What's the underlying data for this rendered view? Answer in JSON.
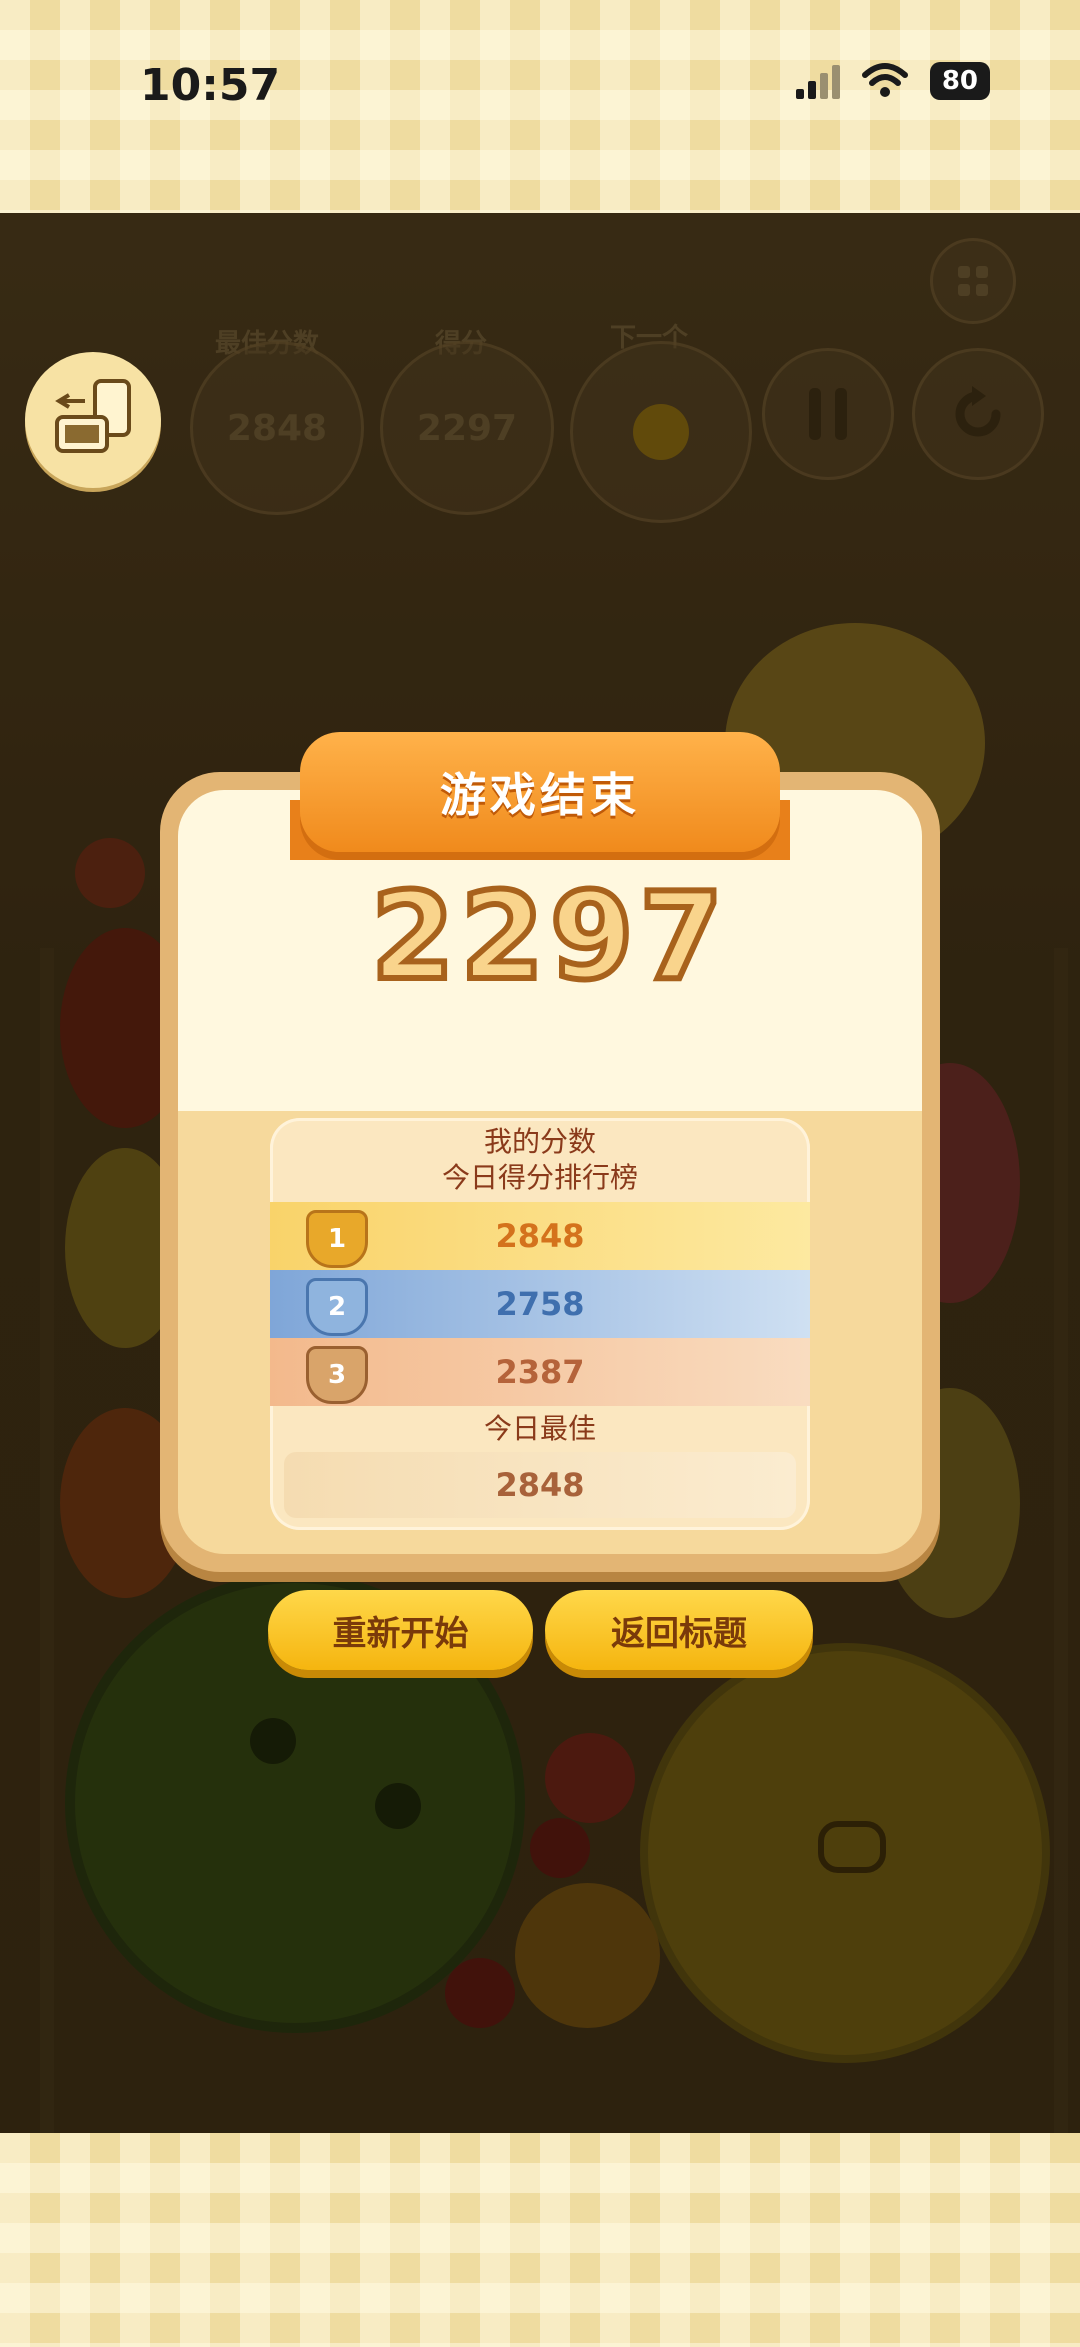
{
  "status_bar": {
    "time": "10:57",
    "battery": "80"
  },
  "hud": {
    "best_label": "最佳分数",
    "best_value": "2848",
    "score_label": "得分",
    "score_value": "2297",
    "next_label": "下一个"
  },
  "dialog": {
    "title": "游戏结束",
    "final_score": "2297",
    "leaderboard": {
      "my_score_label": "我的分数",
      "today_ranking_label": "今日得分排行榜",
      "ranks": [
        {
          "rank": "1",
          "score": "2848"
        },
        {
          "rank": "2",
          "score": "2758"
        },
        {
          "rank": "3",
          "score": "2387"
        }
      ],
      "today_best_label": "今日最佳",
      "today_best_value": "2848"
    },
    "restart_label": "重新开始",
    "back_to_title_label": "返回标题"
  },
  "icons": [
    "rotate-screen-icon",
    "pause-icon",
    "restart-icon",
    "grid-icon",
    "medal-icon",
    "wifi-icon",
    "signal-icon"
  ],
  "colors": {
    "accent": "#f5b50f",
    "ribbon": "#f08a1c",
    "panel": "#e3b574"
  }
}
